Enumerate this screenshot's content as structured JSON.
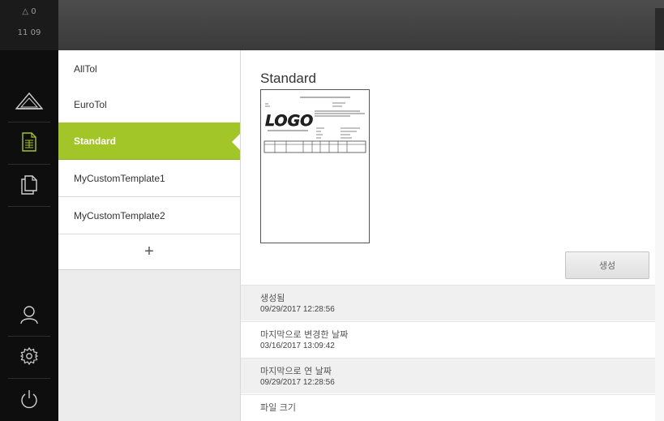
{
  "status": {
    "line1": "△ 0",
    "line2": "11 09"
  },
  "nav": {
    "icons": [
      "measure-icon",
      "document-icon",
      "copy-icon"
    ],
    "bottom_icons": [
      "user-icon",
      "settings-icon",
      "power-icon"
    ]
  },
  "templates": {
    "items": [
      {
        "label": "AllTol"
      },
      {
        "label": "EuroTol"
      },
      {
        "label": "Standard"
      },
      {
        "label": "MyCustomTemplate1"
      },
      {
        "label": "MyCustomTemplate2"
      }
    ],
    "add_label": "+"
  },
  "detail": {
    "title": "Standard",
    "create_label": "생성",
    "info": [
      {
        "label": "생성됨",
        "value": "09/29/2017 12:28:56"
      },
      {
        "label": "마지막으로 변경한 날짜",
        "value": "03/16/2017 13:09:42"
      },
      {
        "label": "마지막으로 연 날짜",
        "value": "09/29/2017 12:28:56"
      },
      {
        "label": "파일 크기",
        "value": ""
      }
    ]
  },
  "preview": {
    "logo_text": "LOGO"
  },
  "colors": {
    "accent": "#a2c527",
    "sidebar": "#0e0e0e",
    "topbar": "#444444"
  }
}
